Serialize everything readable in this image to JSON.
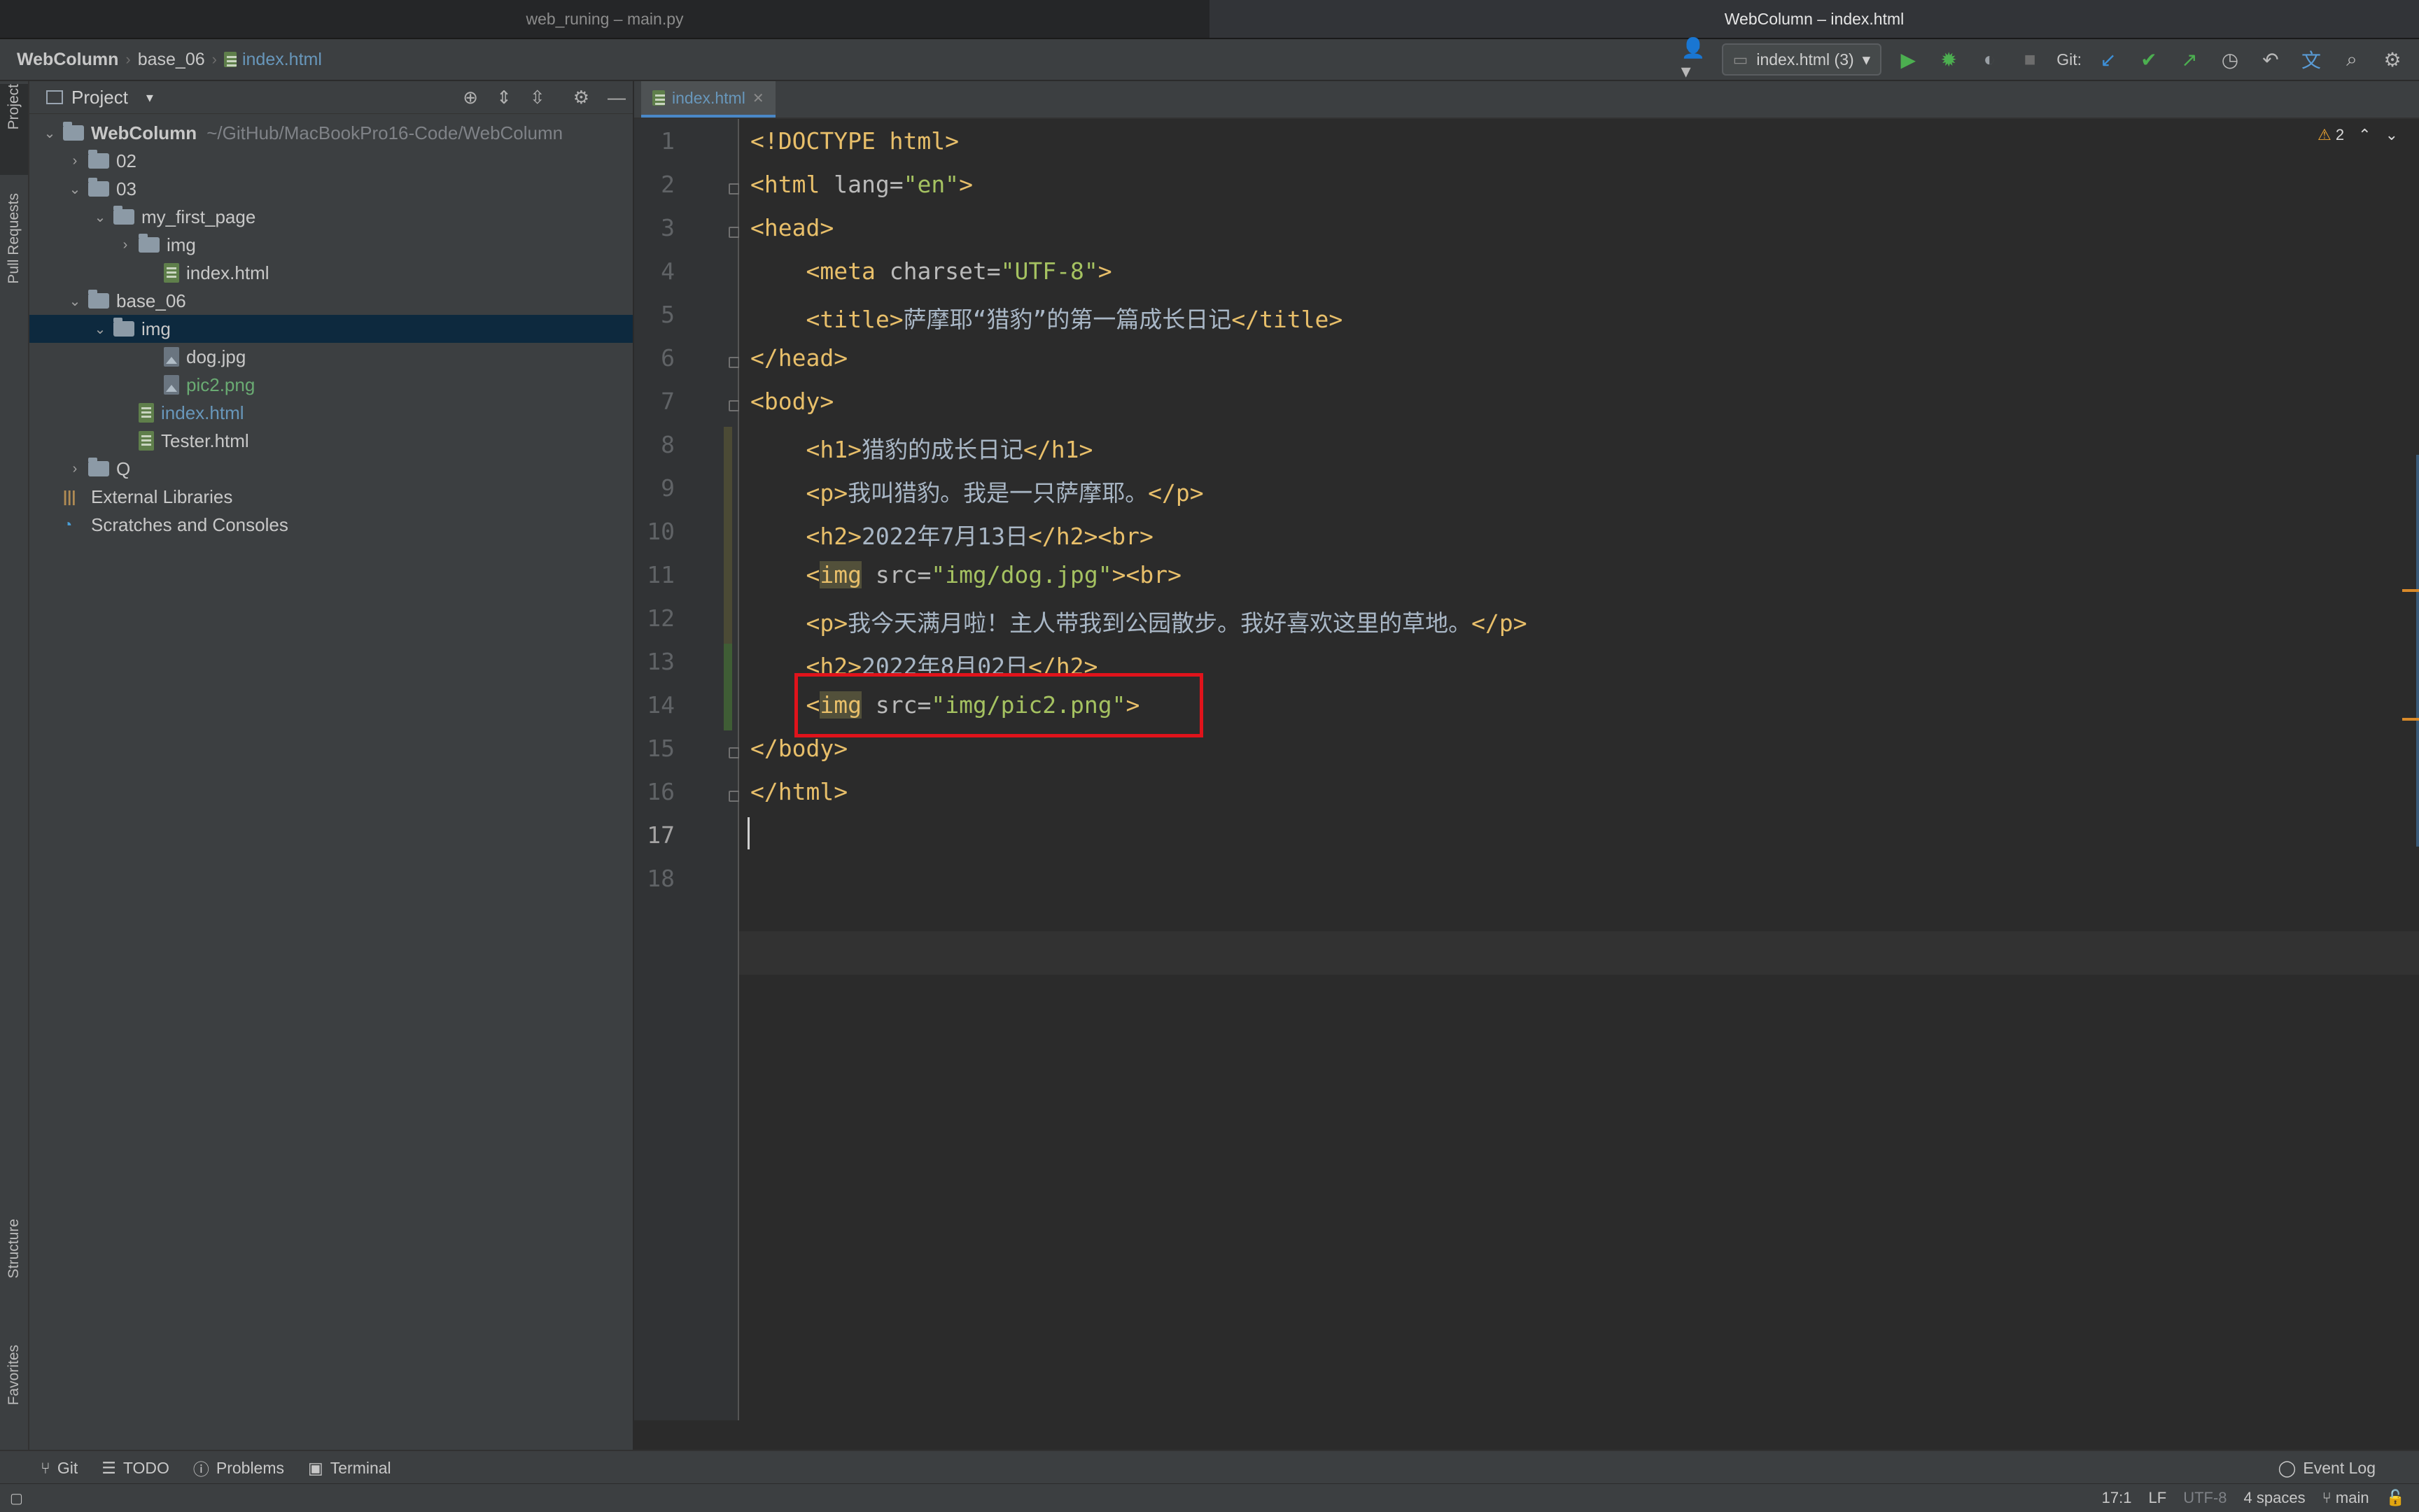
{
  "window_tabs": [
    "web_runing – main.py",
    "WebColumn – index.html"
  ],
  "breadcrumb": [
    "WebColumn",
    "base_06",
    "index.html"
  ],
  "toolbar": {
    "run_config": "index.html (3)",
    "git_label": "Git:"
  },
  "left_strip": {
    "project": "Project",
    "pull_requests": "Pull Requests",
    "structure": "Structure",
    "favorites": "Favorites"
  },
  "project_panel": {
    "title": "Project",
    "tree": [
      {
        "label": "WebColumn",
        "extra": "~/GitHub/MacBookPro16-Code/WebColumn",
        "kind": "folder",
        "depth": 0,
        "open": true,
        "bold": true
      },
      {
        "label": "02",
        "kind": "folder",
        "depth": 1,
        "open": false
      },
      {
        "label": "03",
        "kind": "folder",
        "depth": 1,
        "open": true
      },
      {
        "label": "my_first_page",
        "kind": "folder",
        "depth": 2,
        "open": true
      },
      {
        "label": "img",
        "kind": "folder",
        "depth": 3,
        "open": false
      },
      {
        "label": "index.html",
        "kind": "html",
        "depth": 4
      },
      {
        "label": "base_06",
        "kind": "folder",
        "depth": 1,
        "open": true
      },
      {
        "label": "img",
        "kind": "folder",
        "depth": 2,
        "open": true,
        "selected": true
      },
      {
        "label": "dog.jpg",
        "kind": "image",
        "depth": 4
      },
      {
        "label": "pic2.png",
        "kind": "image",
        "depth": 4,
        "status": "added"
      },
      {
        "label": "index.html",
        "kind": "html",
        "depth": 3,
        "status": "modified"
      },
      {
        "label": "Tester.html",
        "kind": "html",
        "depth": 3
      },
      {
        "label": "Q",
        "kind": "folder",
        "depth": 1,
        "open": false
      },
      {
        "label": "External Libraries",
        "kind": "library",
        "depth": 0
      },
      {
        "label": "Scratches and Consoles",
        "kind": "scratch",
        "depth": 0
      }
    ]
  },
  "editor": {
    "tab": "index.html",
    "warnings": "2",
    "lines": [
      "<!DOCTYPE html>",
      "<html lang=\"en\">",
      "<head>",
      "    <meta charset=\"UTF-8\">",
      "    <title>萨摩耶“猎豹”的第一篇成长日记</title>",
      "</head>",
      "<body>",
      "    <h1>猎豹的成长日记</h1>",
      "    <p>我叫猎豹。我是一只萨摩耶。</p>",
      "    <h2>2022年7月13日</h2><br>",
      "    <img src=\"img/dog.jpg\"><br>",
      "    <p>我今天满月啦！主人带我到公园散步。我好喜欢这里的草地。</p>",
      "    <h2>2022年8月02日</h2>",
      "    <img src=\"img/pic2.png\">",
      "</body>",
      "</html>",
      "",
      ""
    ]
  },
  "bottom_tools": [
    "Git",
    "TODO",
    "Problems",
    "Terminal"
  ],
  "event_log": "Event Log",
  "status_bar": {
    "position": "17:1",
    "line_sep": "LF",
    "encoding": "UTF-8",
    "indent": "4 spaces",
    "branch": "main"
  }
}
